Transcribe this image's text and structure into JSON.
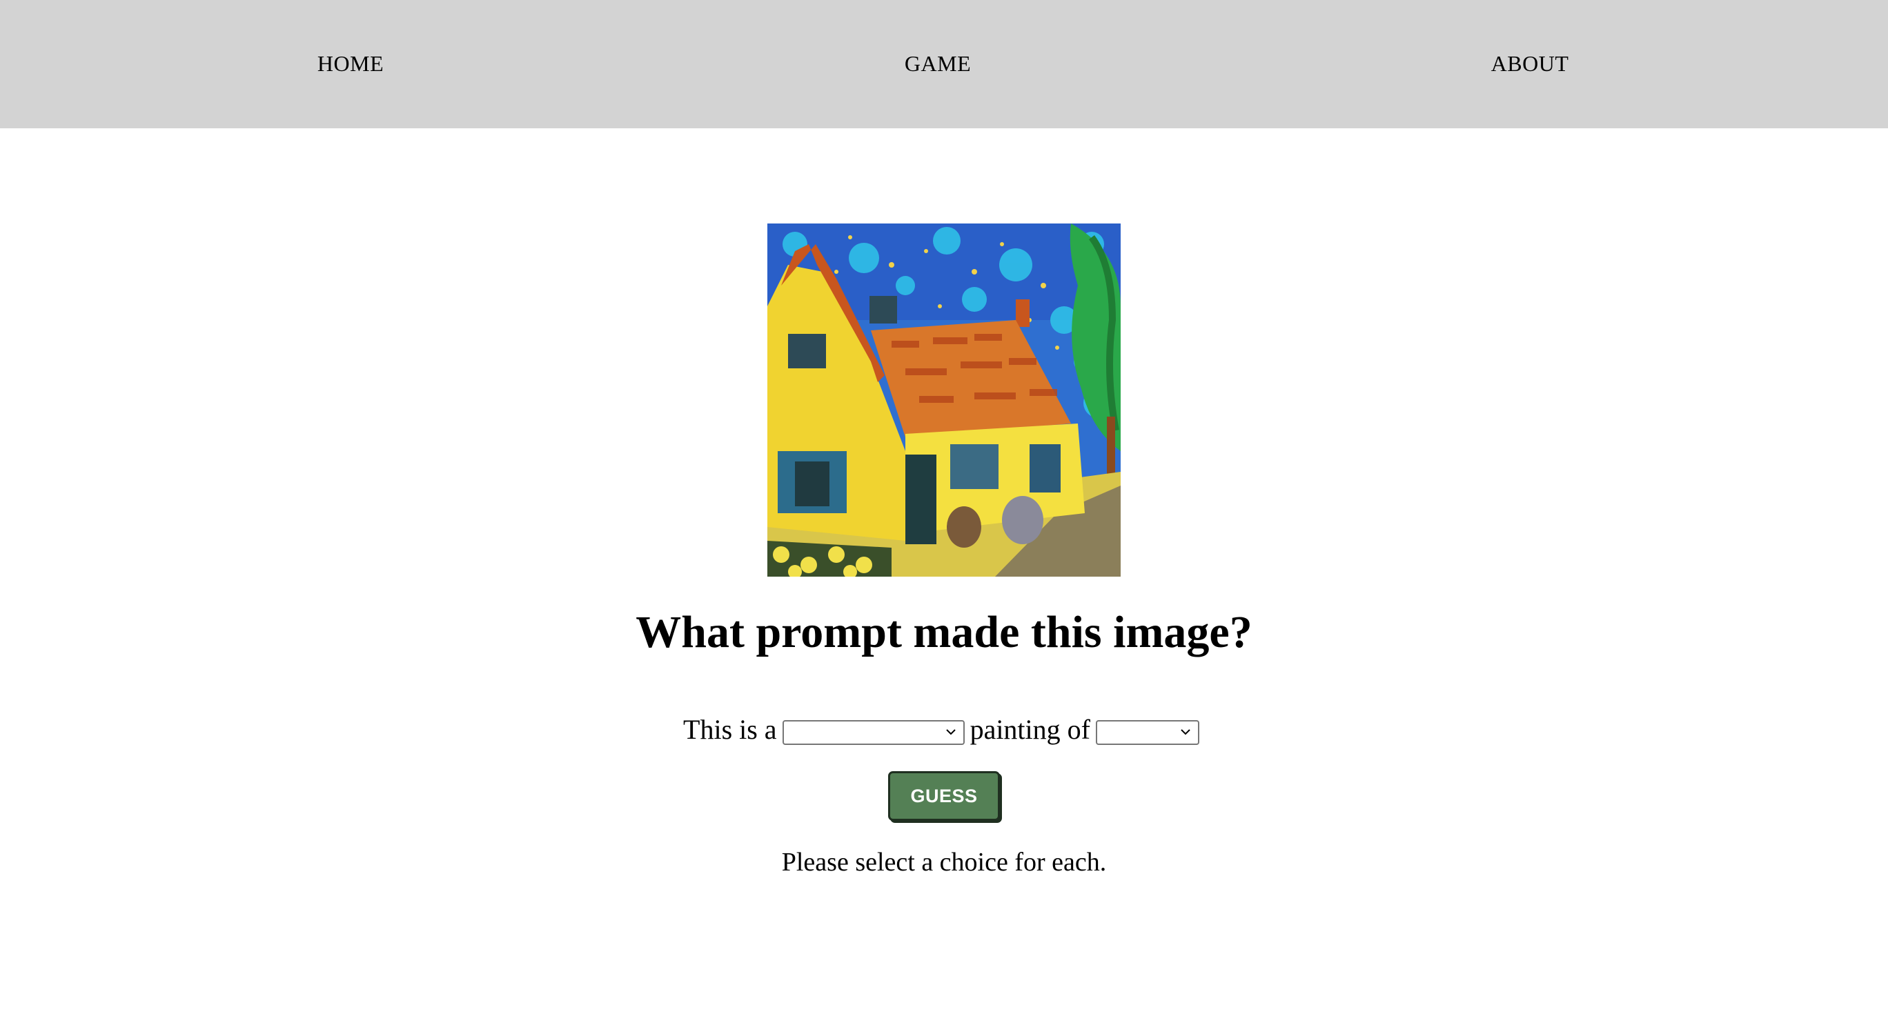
{
  "nav": {
    "home_label": "HOME",
    "game_label": "GAME",
    "about_label": "ABOUT",
    "background_color": "#d3d3d3"
  },
  "painting": {
    "subject": "impressionist painting of a yellow house with orange roof under a starry blue sky"
  },
  "heading": "What prompt made this image?",
  "prompt_form": {
    "prefix": "This is a",
    "style_select_value": "",
    "middle": "painting of",
    "subject_select_value": "",
    "select_icon": "chevron-down-icon"
  },
  "guess_button": {
    "label": "GUESS",
    "color": "#548055"
  },
  "message": "Please select a choice for each."
}
